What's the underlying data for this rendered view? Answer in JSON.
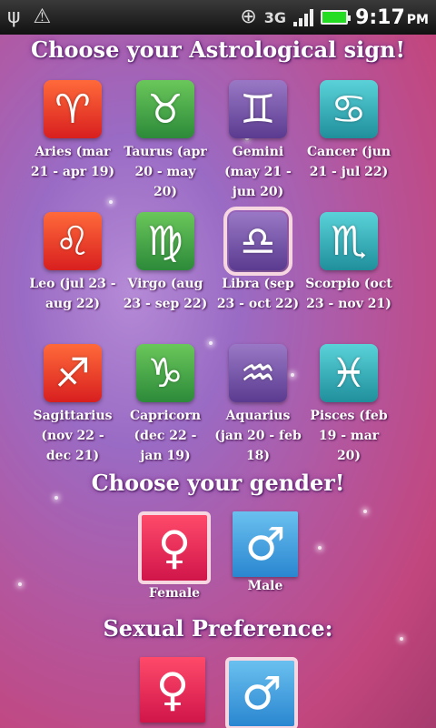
{
  "status_bar": {
    "network": "3G",
    "time": "9:17",
    "ampm": "PM",
    "icons": [
      "usb-icon",
      "warning-icon",
      "gps-icon",
      "signal-icon",
      "battery-icon"
    ]
  },
  "header": {
    "title": "Choose your Astrological sign!"
  },
  "signs": [
    {
      "name": "Aries",
      "range": "(mar 21 - apr 19)",
      "symbol": "♈",
      "element": "fire"
    },
    {
      "name": "Taurus",
      "range": "(apr 20 - may 20)",
      "symbol": "♉",
      "element": "earth"
    },
    {
      "name": "Gemini",
      "range": "(may 21 - jun 20)",
      "symbol": "♊",
      "element": "air"
    },
    {
      "name": "Cancer",
      "range": "(jun 21 - jul 22)",
      "symbol": "♋",
      "element": "water"
    },
    {
      "name": "Leo",
      "range": "(jul 23 - aug 22)",
      "symbol": "♌",
      "element": "fire"
    },
    {
      "name": "Virgo",
      "range": "(aug 23 - sep 22)",
      "symbol": "♍",
      "element": "earth"
    },
    {
      "name": "Libra",
      "range": "(sep 23 - oct 22)",
      "symbol": "♎",
      "element": "air",
      "selected": true
    },
    {
      "name": "Scorpio",
      "range": "(oct 23 - nov 21)",
      "symbol": "♏",
      "element": "water"
    },
    {
      "name": "Sagittarius",
      "range": "(nov 22 - dec 21)",
      "symbol": "♐",
      "element": "fire"
    },
    {
      "name": "Capricorn",
      "range": "(dec 22 - jan 19)",
      "symbol": "♑",
      "element": "earth"
    },
    {
      "name": "Aquarius",
      "range": "(jan 20 - feb 18)",
      "symbol": "♒",
      "element": "air"
    },
    {
      "name": "Pisces",
      "range": "(feb 19 - mar 20)",
      "symbol": "♓",
      "element": "water"
    }
  ],
  "gender": {
    "title": "Choose your gender!",
    "female_label": "Female",
    "male_label": "Male",
    "female_symbol": "♀",
    "male_symbol": "♂",
    "selected": "female"
  },
  "preference": {
    "title": "Sexual Preference:",
    "female_symbol": "♀",
    "male_symbol": "♂",
    "selected": "male"
  },
  "colors": {
    "fire": "#e63a2a",
    "earth": "#3aa048",
    "air": "#6a4aa8",
    "water": "#2aa6b4",
    "female": "#e8285a",
    "male": "#3a9ae0"
  }
}
